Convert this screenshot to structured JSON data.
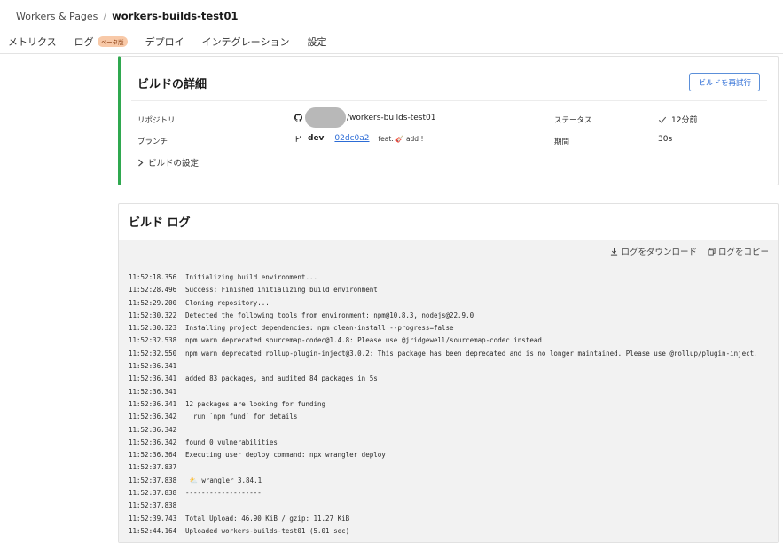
{
  "breadcrumb": {
    "parent": "Workers & Pages",
    "separator": "/",
    "current": "workers-builds-test01"
  },
  "tabs": [
    {
      "label": "メトリクス"
    },
    {
      "label": "ログ",
      "badge": "ベータ版"
    },
    {
      "label": "デプロイ"
    },
    {
      "label": "インテグレーション"
    },
    {
      "label": "設定"
    }
  ],
  "build_details": {
    "title": "ビルドの詳細",
    "retry_label": "ビルドを再試行",
    "repository_label": "リポジトリ",
    "repository_value": "/workers-builds-test01",
    "branch_label": "ブランチ",
    "branch_name": "dev",
    "commit_hash": "02dc0a2",
    "commit_message": "feat: 🎸 add !",
    "status_label": "ステータス",
    "status_value": "12分前",
    "duration_label": "期間",
    "duration_value": "30s",
    "settings_toggle": "ビルドの設定"
  },
  "build_log": {
    "title": "ビルド ログ",
    "download_label": "ログをダウンロード",
    "copy_label": "ログをコピー",
    "lines": [
      {
        "ts": "11:52:18.356",
        "msg": "Initializing build environment..."
      },
      {
        "ts": "11:52:28.496",
        "msg": "Success: Finished initializing build environment"
      },
      {
        "ts": "11:52:29.200",
        "msg": "Cloning repository..."
      },
      {
        "ts": "11:52:30.322",
        "msg": "Detected the following tools from environment: npm@10.8.3, nodejs@22.9.0"
      },
      {
        "ts": "11:52:30.323",
        "msg": "Installing project dependencies: npm clean-install --progress=false"
      },
      {
        "ts": "11:52:32.538",
        "msg": "npm warn deprecated sourcemap-codec@1.4.8: Please use @jridgewell/sourcemap-codec instead"
      },
      {
        "ts": "11:52:32.550",
        "msg": "npm warn deprecated rollup-plugin-inject@3.0.2: This package has been deprecated and is no longer maintained. Please use @rollup/plugin-inject."
      },
      {
        "ts": "11:52:36.341",
        "msg": ""
      },
      {
        "ts": "11:52:36.341",
        "msg": "added 83 packages, and audited 84 packages in 5s"
      },
      {
        "ts": "11:52:36.341",
        "msg": ""
      },
      {
        "ts": "11:52:36.341",
        "msg": "12 packages are looking for funding"
      },
      {
        "ts": "11:52:36.342",
        "msg": "  run `npm fund` for details"
      },
      {
        "ts": "11:52:36.342",
        "msg": ""
      },
      {
        "ts": "11:52:36.342",
        "msg": "found 0 vulnerabilities"
      },
      {
        "ts": "11:52:36.364",
        "msg": "Executing user deploy command: npx wrangler deploy"
      },
      {
        "ts": "11:52:37.837",
        "msg": ""
      },
      {
        "ts": "11:52:37.838",
        "msg": " ⛅️ wrangler 3.84.1"
      },
      {
        "ts": "11:52:37.838",
        "msg": "-------------------"
      },
      {
        "ts": "11:52:37.838",
        "msg": ""
      },
      {
        "ts": "11:52:39.743",
        "msg": "Total Upload: 46.90 KiB / gzip: 11.27 KiB"
      },
      {
        "ts": "11:52:44.164",
        "msg": "Uploaded workers-builds-test01 (5.01 sec)"
      }
    ]
  },
  "colors": {
    "accent": "#2c6cd6",
    "success": "#2fa84f",
    "badge_bg": "#f8c9a8"
  },
  "icons": [
    "github-icon",
    "branch-icon",
    "check-icon",
    "chevron-right-icon",
    "download-icon",
    "copy-icon"
  ]
}
